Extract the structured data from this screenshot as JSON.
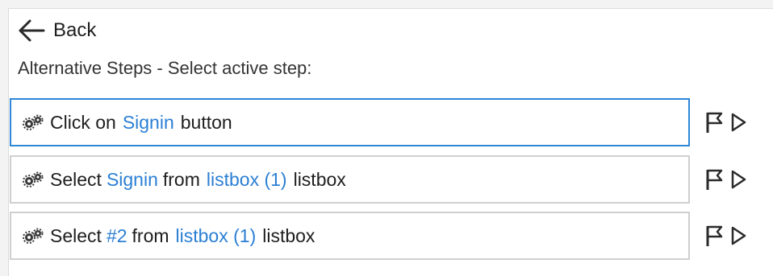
{
  "back": {
    "label": "Back"
  },
  "section_title": "Alternative Steps - Select active step:",
  "steps": [
    {
      "verb": "Click on",
      "target": "Signin",
      "suffix": "button",
      "active": true
    },
    {
      "verb": "Select",
      "value": "Signin",
      "middle": "from",
      "target": "listbox (1)",
      "suffix": "listbox",
      "active": false
    },
    {
      "verb": "Select",
      "value": "#2",
      "middle": "from",
      "target": "listbox (1)",
      "suffix": "listbox",
      "active": false
    }
  ],
  "icons": {
    "back": "arrow-left-icon",
    "step": "gears-icon",
    "flag": "flag-icon",
    "play": "play-icon"
  },
  "colors": {
    "active_border": "#2f87d8",
    "inactive_border": "#cfcfcf",
    "link": "#2b7fd4",
    "text": "#1e1e1e"
  }
}
